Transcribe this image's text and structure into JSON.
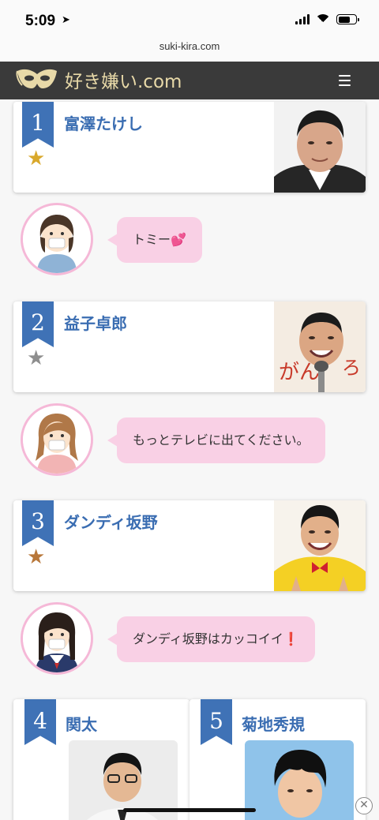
{
  "status": {
    "time": "5:09"
  },
  "browser": {
    "url": "suki-kira.com"
  },
  "site": {
    "logo_text": "好き嫌い.com"
  },
  "ranking": [
    {
      "rank": "1",
      "name": "富澤たけし",
      "comment": "トミー",
      "comment_emoji": "💕"
    },
    {
      "rank": "2",
      "name": "益子卓郎",
      "comment": "もっとテレビに出てください。",
      "comment_emoji": ""
    },
    {
      "rank": "3",
      "name": "ダンディ坂野",
      "comment": "ダンディ坂野はカッコイイ",
      "comment_emoji": "❗"
    },
    {
      "rank": "4",
      "name": "関太"
    },
    {
      "rank": "5",
      "name": "菊地秀規"
    }
  ],
  "colors": {
    "star_gold": "#d9a82b",
    "star_silver": "#8e8e8e",
    "star_bronze": "#b8773a",
    "rank_flag": "#3f72b6"
  }
}
